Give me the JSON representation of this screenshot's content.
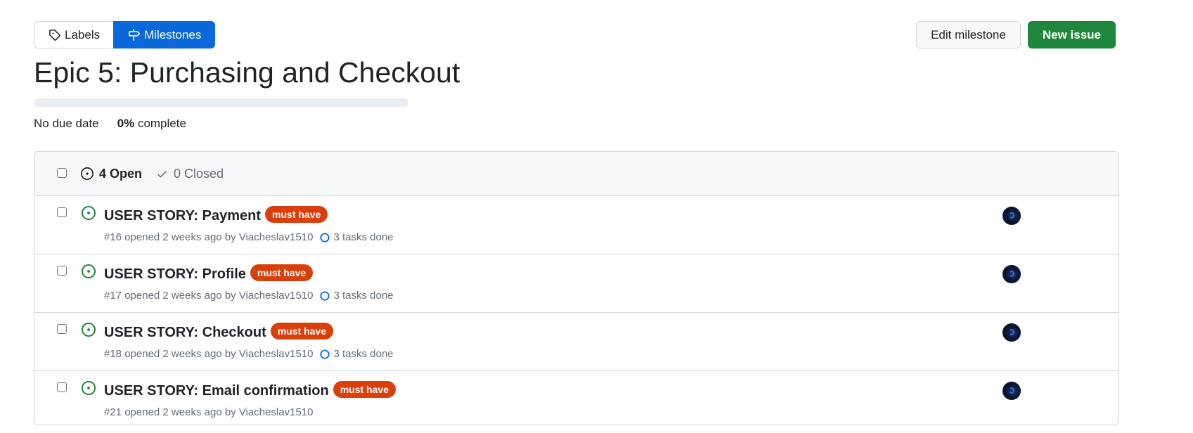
{
  "nav": {
    "labels": "Labels",
    "milestones": "Milestones"
  },
  "actions": {
    "edit": "Edit milestone",
    "new_issue": "New issue"
  },
  "milestone": {
    "title": "Epic 5: Purchasing and Checkout",
    "due": "No due date",
    "percent": "0%",
    "complete_text": " complete",
    "progress_fraction": 0
  },
  "states": {
    "open": "4 Open",
    "closed": "0 Closed"
  },
  "issues": [
    {
      "title": "USER STORY: Payment",
      "label": "must have",
      "number": "#16",
      "opened": "opened 2 weeks ago by",
      "author": "Viacheslav1510",
      "tasks": "3 tasks done"
    },
    {
      "title": "USER STORY: Profile",
      "label": "must have",
      "number": "#17",
      "opened": "opened 2 weeks ago by",
      "author": "Viacheslav1510",
      "tasks": "3 tasks done"
    },
    {
      "title": "USER STORY: Checkout",
      "label": "must have",
      "number": "#18",
      "opened": "opened 2 weeks ago by",
      "author": "Viacheslav1510",
      "tasks": "3 tasks done"
    },
    {
      "title": "USER STORY: Email confirmation",
      "label": "must have",
      "number": "#21",
      "opened": "opened 2 weeks ago by",
      "author": "Viacheslav1510"
    }
  ],
  "colors": {
    "accent": "#0969da",
    "primary": "#1f883d",
    "label": "#d93f0b",
    "open_icon": "#1a7f37"
  }
}
